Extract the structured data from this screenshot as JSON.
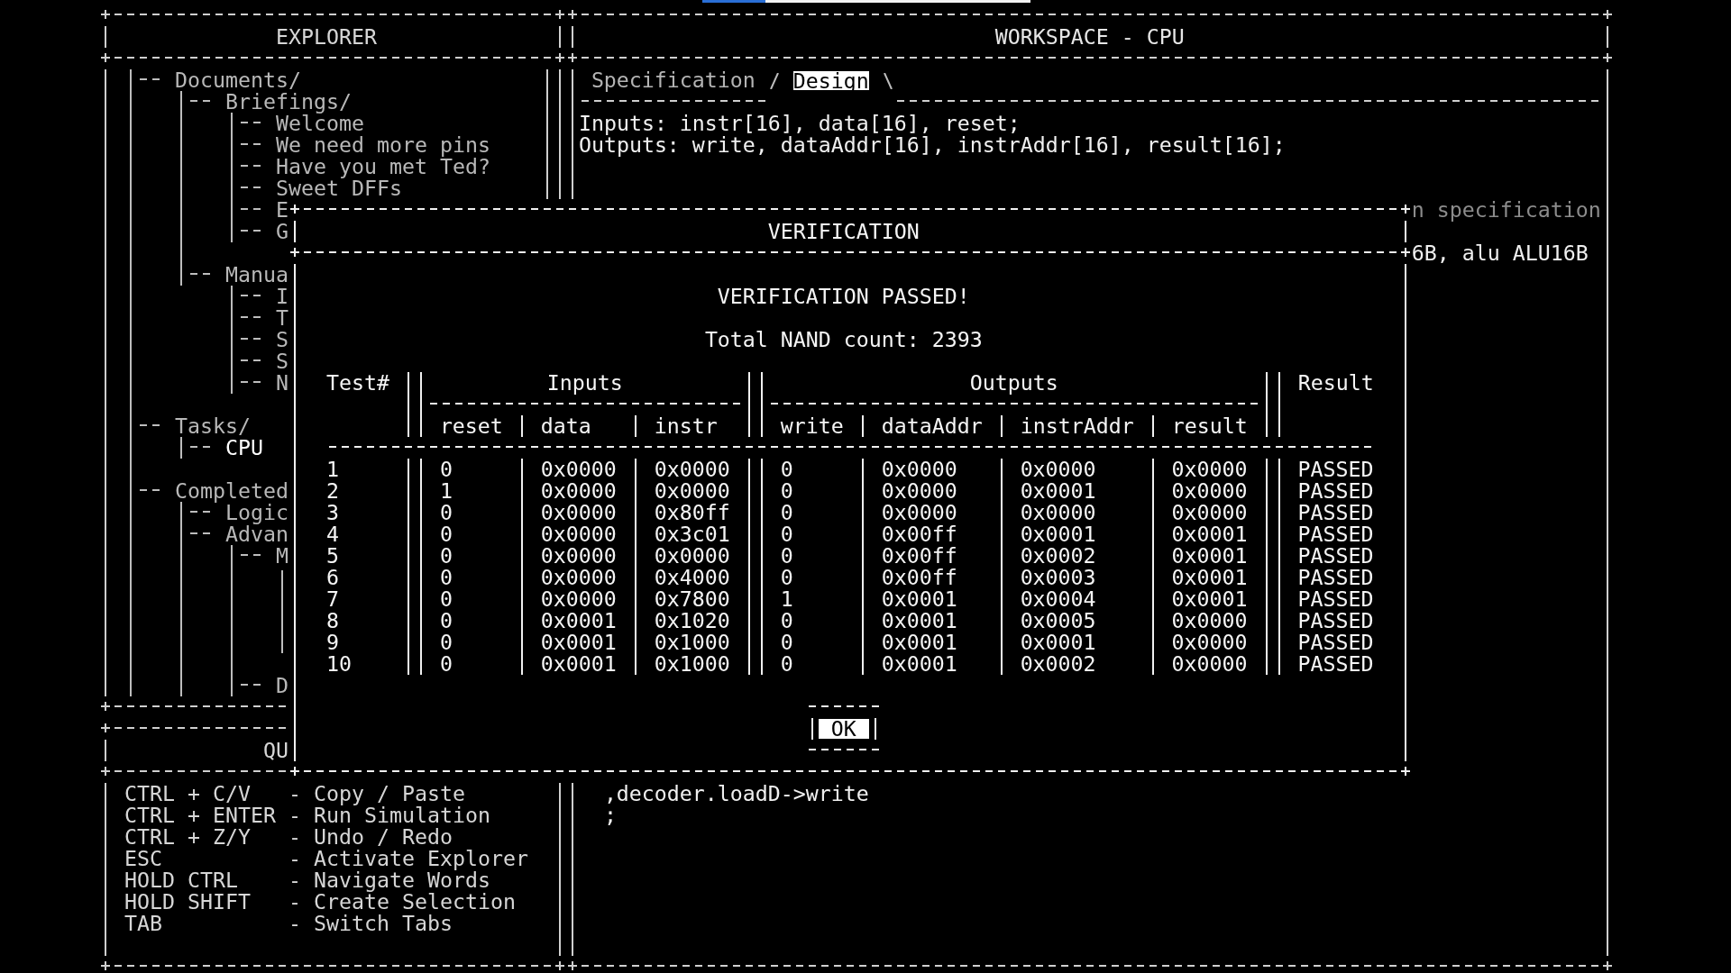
{
  "explorer": {
    "title": "EXPLORER",
    "clipped": true,
    "tree": [
      {
        "label": "Documents/",
        "selected": false,
        "children": [
          {
            "label": "Briefings/",
            "selected": false,
            "children": [
              {
                "label": "Welcome",
                "selected": false
              },
              {
                "label": "We need more pins",
                "selected": false
              },
              {
                "label": "Have you met Ted?",
                "selected": false
              },
              {
                "label": "Sweet DFFs",
                "selected": false
              },
              {
                "label": "E",
                "selected": false
              },
              {
                "label": "G",
                "selected": false
              }
            ]
          },
          {
            "label": "Manua",
            "selected": false,
            "children": [
              {
                "label": "I",
                "selected": false
              },
              {
                "label": "T",
                "selected": false
              },
              {
                "label": "S",
                "selected": false
              },
              {
                "label": "S",
                "selected": false
              },
              {
                "label": "N",
                "selected": false
              }
            ]
          }
        ]
      },
      {
        "label": "Tasks/",
        "selected": false,
        "children": [
          {
            "label": "CPU",
            "selected": true
          }
        ]
      },
      {
        "label": "Completed",
        "selected": false,
        "children": [
          {
            "label": "Logic",
            "selected": false
          },
          {
            "label": "Advan",
            "selected": false,
            "children": [
              {
                "label": "M",
                "selected": false,
                "expanded": true
              },
              {
                "label": "D",
                "selected": false,
                "expanded": false
              }
            ]
          }
        ]
      }
    ],
    "command": "QU"
  },
  "help": [
    {
      "keys": "CTRL + C/V",
      "action": "- Copy / Paste"
    },
    {
      "keys": "CTRL + ENTER",
      "action": "- Run Simulation"
    },
    {
      "keys": "CTRL + Z/Y",
      "action": "- Undo / Redo"
    },
    {
      "keys": "ESC",
      "action": "- Activate Explorer"
    },
    {
      "keys": "HOLD CTRL",
      "action": "- Navigate Words"
    },
    {
      "keys": "HOLD SHIFT",
      "action": "- Create Selection"
    },
    {
      "keys": "TAB",
      "action": "- Switch Tabs"
    }
  ],
  "workspace": {
    "title": "WORKSPACE - CPU",
    "tabs": [
      {
        "label": "Specification",
        "selected": false
      },
      {
        "label": "Design",
        "selected": true
      }
    ],
    "spec_lines": [
      "Inputs: instr[16], data[16], reset;",
      "Outputs: write, dataAddr[16], instrAddr[16], result[16];"
    ],
    "fragments_right": [
      {
        "text": "n specification",
        "kind": "comment"
      },
      {
        "text": "6B, alu ALU16B",
        "kind": "code"
      }
    ],
    "fragments_below": [
      ",decoder.loadD->write",
      ";"
    ]
  },
  "dialog": {
    "title": "VERIFICATION",
    "status": "VERIFICATION PASSED!",
    "summary": "Total NAND count: 2393",
    "table": {
      "test_header": "Test#",
      "groups": [
        {
          "label": "Inputs",
          "columns": [
            "reset",
            "data",
            "instr"
          ]
        },
        {
          "label": "Outputs",
          "columns": [
            "write",
            "dataAddr",
            "instrAddr",
            "result"
          ]
        }
      ],
      "result_header": "Result",
      "rows": [
        {
          "test": "1",
          "inputs": [
            "0",
            "0x0000",
            "0x0000"
          ],
          "outputs": [
            "0",
            "0x0000",
            "0x0000",
            "0x0000"
          ],
          "result": "PASSED"
        },
        {
          "test": "2",
          "inputs": [
            "1",
            "0x0000",
            "0x0000"
          ],
          "outputs": [
            "0",
            "0x0000",
            "0x0001",
            "0x0000"
          ],
          "result": "PASSED"
        },
        {
          "test": "3",
          "inputs": [
            "0",
            "0x0000",
            "0x80ff"
          ],
          "outputs": [
            "0",
            "0x0000",
            "0x0000",
            "0x0000"
          ],
          "result": "PASSED"
        },
        {
          "test": "4",
          "inputs": [
            "0",
            "0x0000",
            "0x3c01"
          ],
          "outputs": [
            "0",
            "0x00ff",
            "0x0001",
            "0x0001"
          ],
          "result": "PASSED"
        },
        {
          "test": "5",
          "inputs": [
            "0",
            "0x0000",
            "0x0000"
          ],
          "outputs": [
            "0",
            "0x00ff",
            "0x0002",
            "0x0001"
          ],
          "result": "PASSED"
        },
        {
          "test": "6",
          "inputs": [
            "0",
            "0x0000",
            "0x4000"
          ],
          "outputs": [
            "0",
            "0x00ff",
            "0x0003",
            "0x0001"
          ],
          "result": "PASSED"
        },
        {
          "test": "7",
          "inputs": [
            "0",
            "0x0000",
            "0x7800"
          ],
          "outputs": [
            "1",
            "0x0001",
            "0x0004",
            "0x0001"
          ],
          "result": "PASSED"
        },
        {
          "test": "8",
          "inputs": [
            "0",
            "0x0001",
            "0x1020"
          ],
          "outputs": [
            "0",
            "0x0001",
            "0x0005",
            "0x0000"
          ],
          "result": "PASSED"
        },
        {
          "test": "9",
          "inputs": [
            "0",
            "0x0001",
            "0x1000"
          ],
          "outputs": [
            "0",
            "0x0001",
            "0x0001",
            "0x0000"
          ],
          "result": "PASSED"
        },
        {
          "test": "10",
          "inputs": [
            "0",
            "0x0001",
            "0x1000"
          ],
          "outputs": [
            "0",
            "0x0001",
            "0x0002",
            "0x0000"
          ],
          "result": "PASSED"
        }
      ]
    },
    "buttons": [
      {
        "label": "OK",
        "focused": true
      }
    ]
  }
}
